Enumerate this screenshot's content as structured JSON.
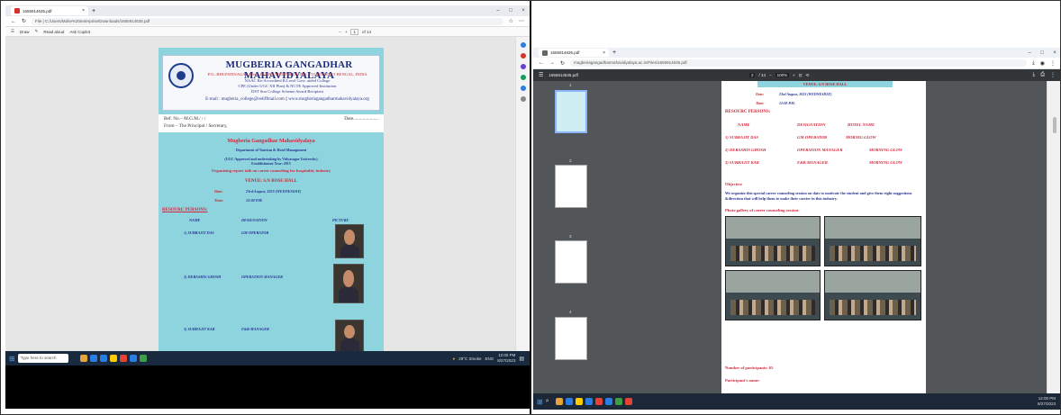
{
  "left_window": {
    "tab_title": "1655914635.pdf",
    "new_tab": "+",
    "window_controls": [
      "–",
      "□",
      "×"
    ],
    "address": "File  |  C:/Users/Mahe%20enterprise/Downloads/1655914635.pdf",
    "toolbar": {
      "draw": "Draw",
      "read_aloud": "Read aloud",
      "ask_copilot": "Ask Copilot",
      "zoom_minus": "−",
      "zoom_plus": "+",
      "page_current": "1",
      "page_total": "of 14"
    },
    "page": {
      "college_name": "MUGBERIA GANGADHAR MAHAVIDYALAYA",
      "address_line": "P.O.–BHUPATINAGAR, Dist.–PURBA MEDINIPUR, PIN.–721425, WEST BENGAL, INDIA",
      "naac_line": "NAAC Re-Accredited B Level Govt. aided College",
      "cpe_line": "CPE (Under UGC XII Plan) & NCTE Approved Institution",
      "dst_line": "DST Star College Scheme Award Recipient",
      "email_line": "E-mail : mugberia_college@rediffmail.com || www.mugberiagangadharmahavidyalaya.org",
      "ref_no": "Ref. No.– M.G.M./          /          /",
      "date_label": "Date.....................",
      "from_line": "From – The Principal / Secretary,",
      "heading": "Mugberia Gangadhar Mahavidyalaya",
      "dept": "Department of Tourism & Hotel Management",
      "ugc": "(UGC Approved and undertaking by Vidyasagar University)",
      "established": "Establishment Year: 2015",
      "organizing": "Organizing report talk on career counseling for hospitality industry",
      "venue": "VENUE:   S.N BOSE HALL",
      "date_row_label": "Date:",
      "date_row_value": "23rd August, 2023 (WEDNESDAY)",
      "time_row_label": "Time:",
      "time_row_value": "12:00 P.M.",
      "resource_heading": "RESOURC PERSONS:",
      "col_name": "NAME",
      "col_designation": "DESIGNATION",
      "col_picture": "PICTURE",
      "persons": [
        {
          "name": "1)  SUBRAJIT DAS",
          "designation": "GM-OPERATOR"
        },
        {
          "name": "2) DEBASHIS GHOSH",
          "designation": "OPERATION MANAGER"
        },
        {
          "name": "3) SUBHAJIT KAR",
          "designation": "F&B MANAGER"
        }
      ]
    },
    "taskbar": {
      "search_placeholder": "Type here to search",
      "weather": "29°C Smoke",
      "lang": "ENG",
      "time": "12:00 PM",
      "date": "8/27/2023"
    }
  },
  "right_window": {
    "tab_title": "1655914635.pdf",
    "new_tab": "+",
    "window_controls": [
      "–",
      "□",
      "×"
    ],
    "address": "mugberiagangadharmahavidyalaya.ac.in/Files/1655914635.pdf",
    "pdf_title": "1655914635.pdf",
    "page_current": "2",
    "page_total": "/ 14",
    "zoom": "100%",
    "thumb_numbers": [
      "1",
      "2",
      "3",
      "4"
    ],
    "page": {
      "venue_bar": "VENUE:   S.N BOSE HALL",
      "date_label": "Date:",
      "date_value": "23rd August, 2023 (WEDNESDAY)",
      "time_label": "Time:",
      "time_value": "12:00 P.M.",
      "resource_heading": "RESOURC PERSONS:",
      "col_name": "NAME",
      "col_designation": "DESIGNATION",
      "col_hotel": "HOTEL NAME",
      "persons": [
        {
          "name": "1)  SUBRAJIT DAS",
          "designation": "GM-OPERATOR",
          "hotel": "MORNIG GLOW"
        },
        {
          "name": "2) DEBASHIS GHOSH",
          "designation": "OPERATION MANAGER",
          "hotel": "MORNING GLOW"
        },
        {
          "name": "3) SUBHAJIT KAR",
          "designation": "F&B MANAGER",
          "hotel": "MORNING GLOW"
        }
      ],
      "objective_label": "Objective",
      "objective_text": "We organize this special career counseling session on date to motivate the student and give them right suggestions &direction that will help them to make their carrier in this industry.",
      "gallery_label": "Photo gallery of career counseling session:",
      "participants_count": "Number of participants: 65",
      "participants_name": "Participant's name:"
    },
    "taskbar": {
      "time": "12:00 PM",
      "date": "8/27/2023"
    }
  },
  "colors": {
    "page_cyan": "#8ed4df",
    "red_text": "#d2263b",
    "blue_text": "#27338f",
    "taskbar": "#1a2a3e"
  }
}
